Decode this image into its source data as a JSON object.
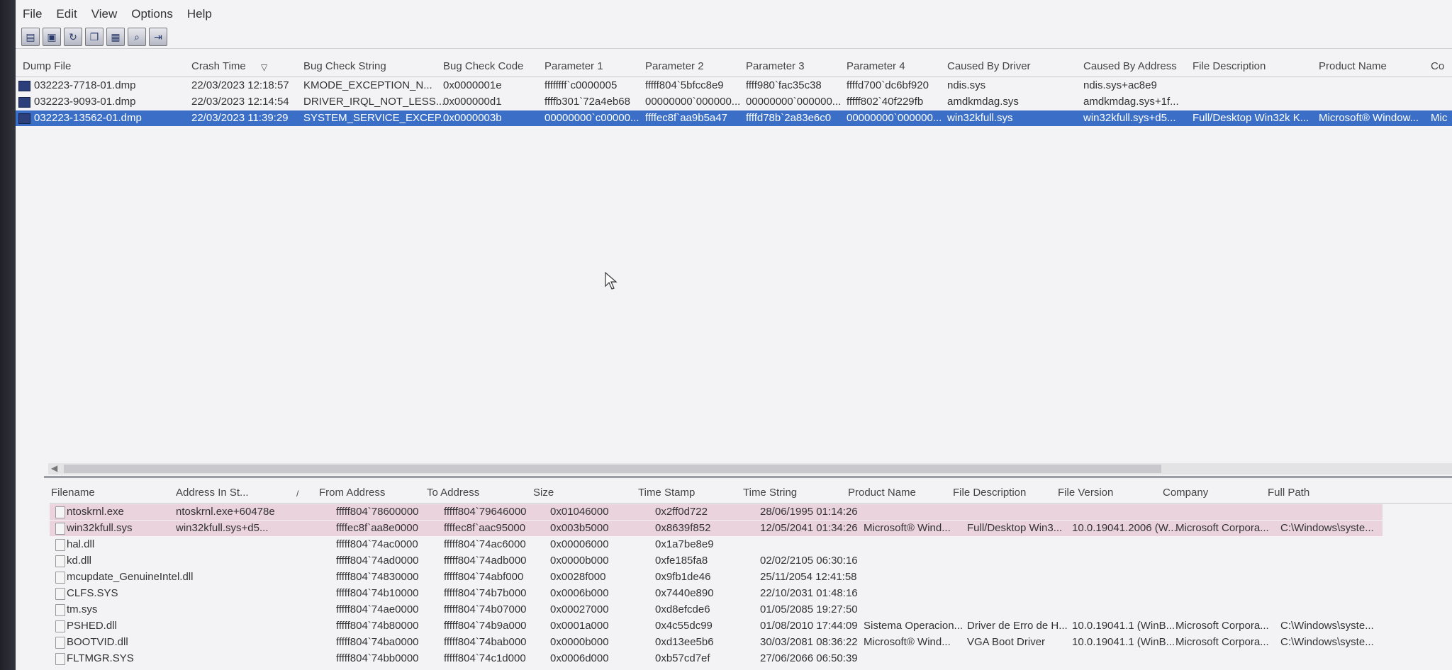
{
  "menu": [
    "File",
    "Edit",
    "View",
    "Options",
    "Help"
  ],
  "toolbar_icons": [
    "save-list-icon",
    "save-icon",
    "refresh-icon",
    "copy-icon",
    "properties-icon",
    "find-icon",
    "exit-icon"
  ],
  "top_columns": [
    "Dump File",
    "Crash Time",
    "Bug Check String",
    "Bug Check Code",
    "Parameter 1",
    "Parameter 2",
    "Parameter 3",
    "Parameter 4",
    "Caused By Driver",
    "Caused By Address",
    "File Description",
    "Product Name",
    "Co"
  ],
  "sort_indicator": "▽",
  "top_rows": [
    {
      "dump": "032223-7718-01.dmp",
      "time": "22/03/2023 12:18:57",
      "str": "KMODE_EXCEPTION_N...",
      "code": "0x0000001e",
      "p1": "ffffffff`c0000005",
      "p2": "fffff804`5bfcc8e9",
      "p3": "ffff980`fac35c38",
      "p4": "ffffd700`dc6bf920",
      "driver": "ndis.sys",
      "addr": "ndis.sys+ac8e9",
      "desc": "",
      "prod": "",
      "co": ""
    },
    {
      "dump": "032223-9093-01.dmp",
      "time": "22/03/2023 12:14:54",
      "str": "DRIVER_IRQL_NOT_LESS...",
      "code": "0x000000d1",
      "p1": "ffffb301`72a4eb68",
      "p2": "00000000`000000...",
      "p3": "00000000`000000...",
      "p4": "fffff802`40f229fb",
      "driver": "amdkmdag.sys",
      "addr": "amdkmdag.sys+1f...",
      "desc": "",
      "prod": "",
      "co": ""
    },
    {
      "dump": "032223-13562-01.dmp",
      "time": "22/03/2023 11:39:29",
      "str": "SYSTEM_SERVICE_EXCEP...",
      "code": "0x0000003b",
      "p1": "00000000`c00000...",
      "p2": "ffffec8f`aa9b5a47",
      "p3": "ffffd78b`2a83e6c0",
      "p4": "00000000`000000...",
      "driver": "win32kfull.sys",
      "addr": "win32kfull.sys+d5...",
      "desc": "Full/Desktop Win32k K...",
      "prod": "Microsoft® Window...",
      "co": "Mic"
    }
  ],
  "bottom_columns": [
    "Filename",
    "Address In St...",
    "From Address",
    "To Address",
    "Size",
    "Time Stamp",
    "Time String",
    "Product Name",
    "File Description",
    "File Version",
    "Company",
    "Full Path"
  ],
  "bottom_sort_indicator": "/",
  "bottom_rows": [
    {
      "name": "ntoskrnl.exe",
      "addr": "ntoskrnl.exe+60478e",
      "from": "fffff804`78600000",
      "to": "fffff804`79646000",
      "size": "0x01046000",
      "stamp": "0x2ff0d722",
      "tstr": "28/06/1995 01:14:26",
      "prod": "",
      "desc": "",
      "ver": "",
      "company": "",
      "path": ""
    },
    {
      "name": "win32kfull.sys",
      "addr": "win32kfull.sys+d5...",
      "from": "ffffec8f`aa8e0000",
      "to": "ffffec8f`aac95000",
      "size": "0x003b5000",
      "stamp": "0x8639f852",
      "tstr": "12/05/2041 01:34:26",
      "prod": "Microsoft® Wind...",
      "desc": "Full/Desktop Win3...",
      "ver": "10.0.19041.2006 (W...",
      "company": "Microsoft Corpora...",
      "path": "C:\\Windows\\syste..."
    },
    {
      "name": "hal.dll",
      "addr": "",
      "from": "fffff804`74ac0000",
      "to": "fffff804`74ac6000",
      "size": "0x00006000",
      "stamp": "0x1a7be8e9",
      "tstr": "",
      "prod": "",
      "desc": "",
      "ver": "",
      "company": "",
      "path": ""
    },
    {
      "name": "kd.dll",
      "addr": "",
      "from": "fffff804`74ad0000",
      "to": "fffff804`74adb000",
      "size": "0x0000b000",
      "stamp": "0xfe185fa8",
      "tstr": "02/02/2105 06:30:16",
      "prod": "",
      "desc": "",
      "ver": "",
      "company": "",
      "path": ""
    },
    {
      "name": "mcupdate_GenuineIntel.dll",
      "addr": "",
      "from": "fffff804`74830000",
      "to": "fffff804`74abf000",
      "size": "0x0028f000",
      "stamp": "0x9fb1de46",
      "tstr": "25/11/2054 12:41:58",
      "prod": "",
      "desc": "",
      "ver": "",
      "company": "",
      "path": ""
    },
    {
      "name": "CLFS.SYS",
      "addr": "",
      "from": "fffff804`74b10000",
      "to": "fffff804`74b7b000",
      "size": "0x0006b000",
      "stamp": "0x7440e890",
      "tstr": "22/10/2031 01:48:16",
      "prod": "",
      "desc": "",
      "ver": "",
      "company": "",
      "path": ""
    },
    {
      "name": "tm.sys",
      "addr": "",
      "from": "fffff804`74ae0000",
      "to": "fffff804`74b07000",
      "size": "0x00027000",
      "stamp": "0xd8efcde6",
      "tstr": "01/05/2085 19:27:50",
      "prod": "",
      "desc": "",
      "ver": "",
      "company": "",
      "path": ""
    },
    {
      "name": "PSHED.dll",
      "addr": "",
      "from": "fffff804`74b80000",
      "to": "fffff804`74b9a000",
      "size": "0x0001a000",
      "stamp": "0x4c55dc99",
      "tstr": "01/08/2010 17:44:09",
      "prod": "Sistema Operacion...",
      "desc": "Driver de Erro de H...",
      "ver": "10.0.19041.1 (WinB...",
      "company": "Microsoft Corpora...",
      "path": "C:\\Windows\\syste..."
    },
    {
      "name": "BOOTVID.dll",
      "addr": "",
      "from": "fffff804`74ba0000",
      "to": "fffff804`74bab000",
      "size": "0x0000b000",
      "stamp": "0xd13ee5b6",
      "tstr": "30/03/2081 08:36:22",
      "prod": "Microsoft® Wind...",
      "desc": "VGA Boot Driver",
      "ver": "10.0.19041.1 (WinB...",
      "company": "Microsoft Corpora...",
      "path": "C:\\Windows\\syste..."
    },
    {
      "name": "FLTMGR.SYS",
      "addr": "",
      "from": "fffff804`74bb0000",
      "to": "fffff804`74c1d000",
      "size": "0x0006d000",
      "stamp": "0xb57cd7ef",
      "tstr": "27/06/2066 06:50:39",
      "prod": "",
      "desc": "",
      "ver": "",
      "company": "",
      "path": ""
    }
  ],
  "colors": {
    "selection": "#3b6fc7",
    "highlight_row": "#ead3dc"
  }
}
